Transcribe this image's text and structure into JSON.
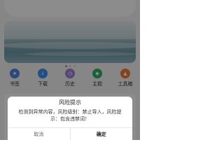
{
  "colors": {
    "history_icon": "#9f80d8",
    "theme_icon": "#2fb06c",
    "bookshelf_icon": "#4f85e0",
    "download_icon": "#3d8ff0",
    "toolbox_icon": "#f07b3a"
  },
  "quick_nav": [
    {
      "label": "书签",
      "icon": "bookmark-icon",
      "glyph": "★"
    },
    {
      "label": "下载",
      "icon": "download-icon",
      "glyph": "↓"
    },
    {
      "label": "历史",
      "icon": "history-icon",
      "glyph": "◷"
    },
    {
      "label": "主题",
      "icon": "theme-icon",
      "glyph": "◆"
    },
    {
      "label": "工具箱",
      "icon": "toolbox-icon",
      "glyph": "▲"
    }
  ],
  "dialog": {
    "title": "风险提示",
    "message": "检测到异常内容，风险级别：禁止导入，风险提示：包含违禁词！",
    "cancel_label": "取消",
    "confirm_label": "确定"
  }
}
